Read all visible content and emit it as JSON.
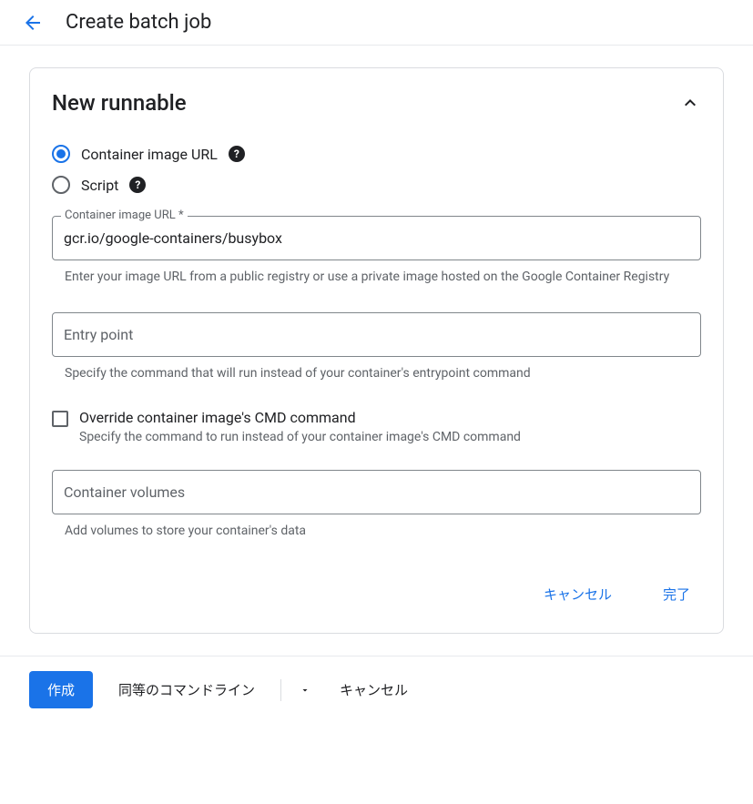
{
  "header": {
    "title": "Create batch job"
  },
  "card": {
    "title": "New runnable",
    "radios": {
      "container": "Container image URL",
      "script": "Script"
    },
    "containerUrl": {
      "label": "Container image URL *",
      "value": "gcr.io/google-containers/busybox",
      "helper": "Enter your image URL from a public registry or use a private image hosted on the Google Container Registry"
    },
    "entryPoint": {
      "placeholder": "Entry point",
      "helper": "Specify the command that will run instead of your container's entrypoint command"
    },
    "overrideCmd": {
      "label": "Override container image's CMD command",
      "helper": "Specify the command to run instead of your container image's CMD command"
    },
    "volumes": {
      "placeholder": "Container volumes",
      "helper": "Add volumes to store your container's data"
    },
    "actions": {
      "cancel": "キャンセル",
      "done": "完了"
    }
  },
  "footer": {
    "create": "作成",
    "equivalent": "同等のコマンドライン",
    "cancel": "キャンセル"
  }
}
